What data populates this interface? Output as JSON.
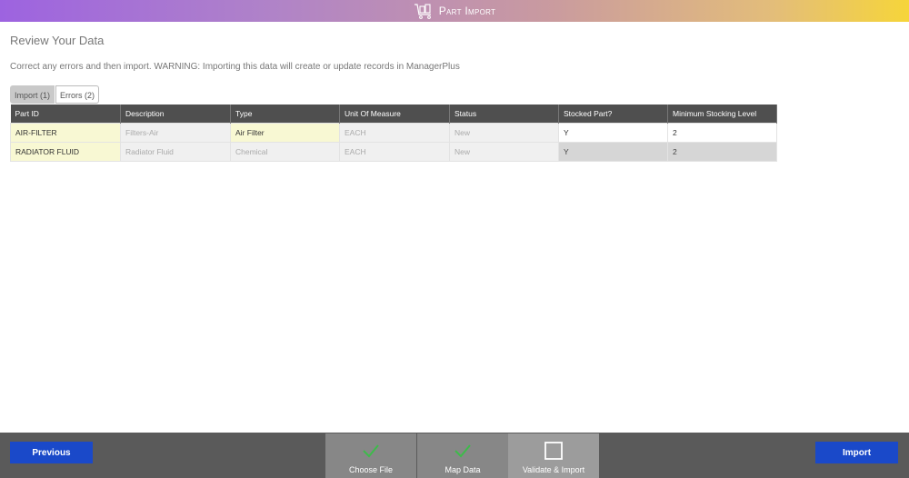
{
  "header": {
    "title": "Part Import",
    "icon": "cart-boxes-icon"
  },
  "page": {
    "title": "Review Your Data",
    "instructions": "Correct any errors and then import. WARNING: Importing this data will create or update records in ManagerPlus"
  },
  "tabs": [
    {
      "label": "Import (1)",
      "active": true
    },
    {
      "label": "Errors (2)",
      "active": false
    }
  ],
  "table": {
    "columns": [
      "Part ID",
      "Description",
      "Type",
      "Unit Of Measure",
      "Status",
      "Stocked Part?",
      "Minimum Stocking Level"
    ],
    "rows": [
      [
        "AIR-FILTER",
        "Filters-Air",
        "Air Filter",
        "EACH",
        "New",
        "Y",
        "2"
      ],
      [
        "RADIATOR FLUID",
        "Radiator Fluid",
        "Chemical",
        "EACH",
        "New",
        "Y",
        "2"
      ]
    ]
  },
  "footer": {
    "previous_label": "Previous",
    "import_label": "Import",
    "steps": [
      {
        "label": "Choose File",
        "icon": "checkmark-icon",
        "state": "done"
      },
      {
        "label": "Map Data",
        "icon": "checkmark-icon",
        "state": "done"
      },
      {
        "label": "Validate & Import",
        "icon": "empty-square-icon",
        "state": "current"
      }
    ]
  },
  "colors": {
    "header_gradient_start": "#9d63e0",
    "header_gradient_end": "#f6d53a",
    "button_blue": "#1a49c9",
    "table_header": "#4f4f4f",
    "highlight_yellow": "#f8f8d3",
    "step_check_green": "#3dbb4a"
  }
}
